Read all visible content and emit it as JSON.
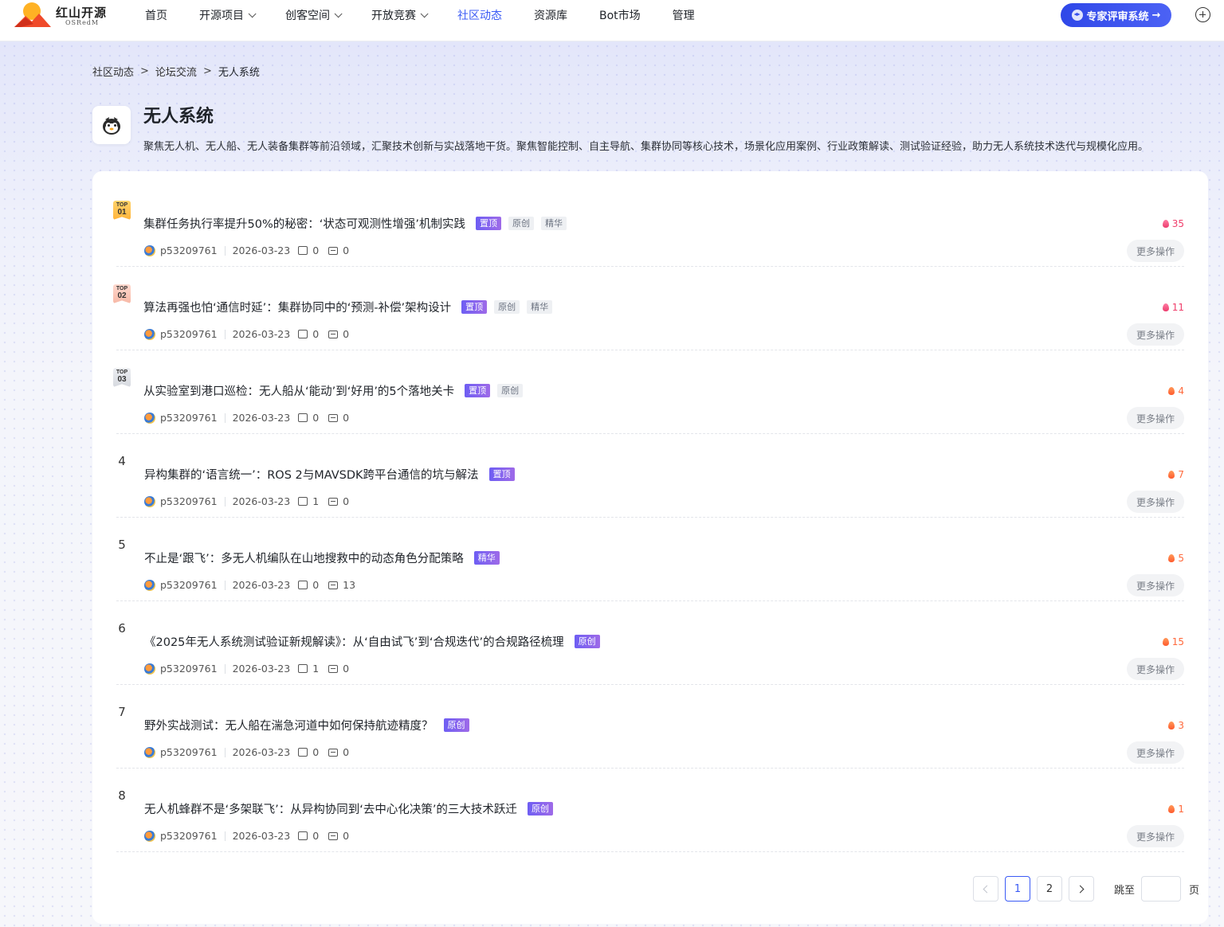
{
  "brand": {
    "title": "红山开源",
    "subtitle": "OSRedM"
  },
  "nav": [
    {
      "label": "首页",
      "dropdown": false,
      "active": false
    },
    {
      "label": "开源项目",
      "dropdown": true,
      "active": false
    },
    {
      "label": "创客空间",
      "dropdown": true,
      "active": false
    },
    {
      "label": "开放竞赛",
      "dropdown": true,
      "active": false
    },
    {
      "label": "社区动态",
      "dropdown": false,
      "active": true
    },
    {
      "label": "资源库",
      "dropdown": false,
      "active": false
    },
    {
      "label": "Bot市场",
      "dropdown": false,
      "active": false
    },
    {
      "label": "管理",
      "dropdown": false,
      "active": false
    }
  ],
  "expert_button": {
    "label": "专家评审系统",
    "arrow": "→"
  },
  "breadcrumb": [
    "社区动态",
    "论坛交流",
    "无人系统"
  ],
  "breadcrumb_sep": ">",
  "board": {
    "title": "无人系统",
    "description": "聚焦无人机、无人船、无人装备集群等前沿领域，汇聚技术创新与实战落地干货。聚焦智能控制、自主导航、集群协同等核心技术，场景化应用案例、行业政策解读、测试验证经验，助力无人系统技术迭代与规模化应用。"
  },
  "posts": [
    {
      "rank": "01",
      "top": true,
      "title": "集群任务执行率提升50%的秘密：‘状态可观测性增强’机制实践",
      "tags": [
        {
          "t": "置顶",
          "k": "pin"
        },
        {
          "t": "原创",
          "k": "orig-g"
        },
        {
          "t": "精华",
          "k": "ess-g"
        }
      ],
      "author": "p53209761",
      "date": "2026-03-23",
      "likes": "0",
      "comments": "0",
      "hot": "35",
      "hot_color": "pink"
    },
    {
      "rank": "02",
      "top": true,
      "title": "算法再强也怕‘通信时延’：集群协同中的‘预测-补偿’架构设计",
      "tags": [
        {
          "t": "置顶",
          "k": "pin"
        },
        {
          "t": "原创",
          "k": "orig-g"
        },
        {
          "t": "精华",
          "k": "ess-g"
        }
      ],
      "author": "p53209761",
      "date": "2026-03-23",
      "likes": "0",
      "comments": "0",
      "hot": "11",
      "hot_color": "pink"
    },
    {
      "rank": "03",
      "top": true,
      "title": "从实验室到港口巡检：无人船从‘能动’到‘好用’的5个落地关卡",
      "tags": [
        {
          "t": "置顶",
          "k": "pin"
        },
        {
          "t": "原创",
          "k": "orig-g"
        }
      ],
      "author": "p53209761",
      "date": "2026-03-23",
      "likes": "0",
      "comments": "0",
      "hot": "4",
      "hot_color": "orange"
    },
    {
      "rank": "4",
      "top": false,
      "title": "异构集群的‘语言统一’：ROS 2与MAVSDK跨平台通信的坑与解法",
      "tags": [
        {
          "t": "置顶",
          "k": "pin"
        }
      ],
      "author": "p53209761",
      "date": "2026-03-23",
      "likes": "1",
      "comments": "0",
      "hot": "7",
      "hot_color": "orange"
    },
    {
      "rank": "5",
      "top": false,
      "title": "不止是‘跟飞’：多无人机编队在山地搜救中的动态角色分配策略",
      "tags": [
        {
          "t": "精华",
          "k": "purple"
        }
      ],
      "author": "p53209761",
      "date": "2026-03-23",
      "likes": "0",
      "comments": "13",
      "hot": "5",
      "hot_color": "orange"
    },
    {
      "rank": "6",
      "top": false,
      "title": "《2025年无人系统测试验证新规解读》：从‘自由试飞’到‘合规迭代’的合规路径梳理",
      "tags": [
        {
          "t": "原创",
          "k": "purple"
        }
      ],
      "author": "p53209761",
      "date": "2026-03-23",
      "likes": "1",
      "comments": "0",
      "hot": "15",
      "hot_color": "orange"
    },
    {
      "rank": "7",
      "top": false,
      "title": "野外实战测试：无人船在湍急河道中如何保持航迹精度？",
      "tags": [
        {
          "t": "原创",
          "k": "purple"
        }
      ],
      "author": "p53209761",
      "date": "2026-03-23",
      "likes": "0",
      "comments": "0",
      "hot": "3",
      "hot_color": "orange"
    },
    {
      "rank": "8",
      "top": false,
      "title": "无人机蜂群不是‘多架联飞’：从异构协同到‘去中心化决策’的三大技术跃迁",
      "tags": [
        {
          "t": "原创",
          "k": "purple"
        }
      ],
      "author": "p53209761",
      "date": "2026-03-23",
      "likes": "0",
      "comments": "0",
      "hot": "1",
      "hot_color": "orange"
    }
  ],
  "top_label": "TOP",
  "more_label": "更多操作",
  "pagination": {
    "pages": [
      "1",
      "2"
    ],
    "current": "1",
    "jump_label": "跳至",
    "page_label": "页",
    "jump_value": ""
  }
}
